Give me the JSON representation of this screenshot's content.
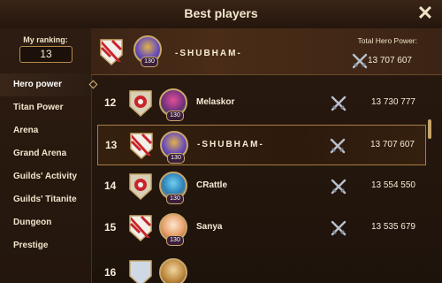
{
  "window": {
    "title": "Best players",
    "close_label": "✕"
  },
  "sidebar": {
    "my_ranking_label": "My ranking:",
    "my_ranking_value": "13",
    "items": [
      {
        "label": "Hero power",
        "active": true
      },
      {
        "label": "Titan Power",
        "active": false
      },
      {
        "label": "Arena",
        "active": false
      },
      {
        "label": "Grand Arena",
        "active": false
      },
      {
        "label": "Guilds' Activity",
        "active": false
      },
      {
        "label": "Guilds' Titanite",
        "active": false
      },
      {
        "label": "Dungeon",
        "active": false
      },
      {
        "label": "Prestige",
        "active": false
      }
    ]
  },
  "my_entry": {
    "name": "-SHUBHAM-",
    "level": "130",
    "power_label": "Total Hero Power:",
    "power": "13 707 607"
  },
  "players": [
    {
      "rank": "12",
      "name": "Melaskor",
      "level": "130",
      "power": "13 730 777"
    },
    {
      "rank": "13",
      "name": "-SHUBHAM-",
      "level": "130",
      "power": "13 707 607"
    },
    {
      "rank": "14",
      "name": "CRattle",
      "level": "130",
      "power": "13 554 550"
    },
    {
      "rank": "15",
      "name": "Sanya",
      "level": "130",
      "power": "13 535 679"
    },
    {
      "rank": "16",
      "name": "",
      "level": "",
      "power": ""
    }
  ],
  "colors": {
    "shield_red": "#c8242a",
    "shield_white": "#f2efe8",
    "gold": "#c9a86a"
  }
}
